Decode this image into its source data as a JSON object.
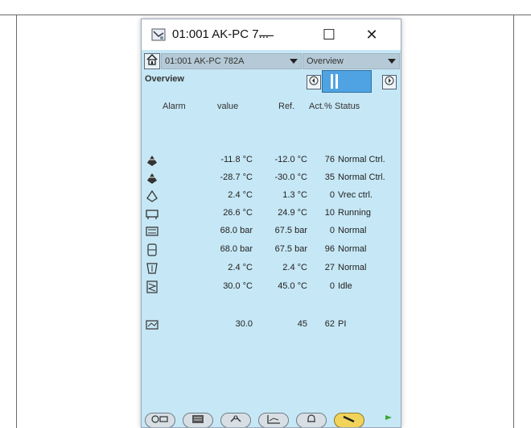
{
  "window": {
    "title": "01:001 AK-PC 7...",
    "minimize_glyph": "—",
    "maximize_glyph": "☐",
    "close_glyph": "✕"
  },
  "toolbar": {
    "controller_value": "01:001 AK-PC 782A",
    "view_value": "Overview"
  },
  "view_label": "Overview",
  "columns": {
    "alarm": "Alarm",
    "value": "value",
    "ref": "Ref.",
    "act": "Act.%",
    "status": "Status"
  },
  "rows": [
    {
      "icon": "evaporator-icon",
      "value": "-11.8 °C",
      "ref": "-12.0 °C",
      "act": "76",
      "status": "Normal Ctrl."
    },
    {
      "icon": "evaporator-icon",
      "value": "-28.7 °C",
      "ref": "-30.0 °C",
      "act": "35",
      "status": "Normal Ctrl."
    },
    {
      "icon": "evaporator-outline-icon",
      "value": "2.4 °C",
      "ref": "1.3 °C",
      "act": "0",
      "status": "Vrec ctrl."
    },
    {
      "icon": "compressor-icon",
      "value": "26.6 °C",
      "ref": "24.9 °C",
      "act": "10",
      "status": "Running"
    },
    {
      "icon": "condenser-icon",
      "value": "68.0 bar",
      "ref": "67.5 bar",
      "act": "0",
      "status": "Normal"
    },
    {
      "icon": "receiver-icon",
      "value": "68.0 bar",
      "ref": "67.5 bar",
      "act": "96",
      "status": "Normal"
    },
    {
      "icon": "gas-cooler-icon",
      "value": "2.4 °C",
      "ref": "2.4 °C",
      "act": "27",
      "status": "Normal"
    },
    {
      "icon": "heat-exchanger-icon",
      "value": "30.0 °C",
      "ref": "45.0 °C",
      "act": "0",
      "status": "Idle"
    },
    {
      "icon": "pi-controller-icon",
      "value": "30.0",
      "ref": "45",
      "act": "62",
      "status": "PI"
    }
  ],
  "tabs": [
    {
      "name": "tab-overview",
      "icon": "plant-overview-icon",
      "active": false
    },
    {
      "name": "tab-display",
      "icon": "display-icon",
      "active": false
    },
    {
      "name": "tab-tools",
      "icon": "tools-icon",
      "active": false
    },
    {
      "name": "tab-graph",
      "icon": "graph-icon",
      "active": false
    },
    {
      "name": "tab-alarms",
      "icon": "bell-icon",
      "active": false
    },
    {
      "name": "tab-settings",
      "icon": "wrench-icon",
      "active": true
    }
  ],
  "colors": {
    "app_background": "#c6e7f5",
    "nav_display": "#4fa3e3",
    "active_tab": "#f1d35a",
    "status_led": "#3aa83a"
  }
}
